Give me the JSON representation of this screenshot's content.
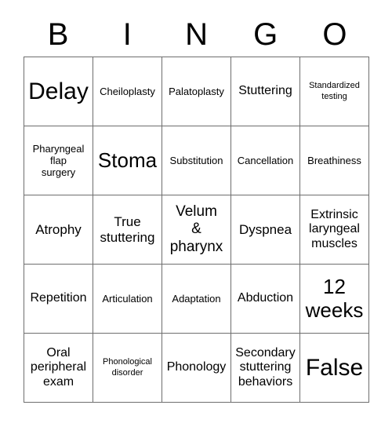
{
  "card": {
    "headers": [
      "B",
      "I",
      "N",
      "G",
      "O"
    ],
    "rows": [
      [
        {
          "text": "Delay",
          "size": "huge"
        },
        {
          "text": "Cheiloplasty",
          "size": "sm"
        },
        {
          "text": "Palatoplasty",
          "size": "sm"
        },
        {
          "text": "Stuttering",
          "size": "md"
        },
        {
          "text": "Standardized\ntesting",
          "size": "xs"
        }
      ],
      [
        {
          "text": "Pharyngeal\nflap\nsurgery",
          "size": "sm"
        },
        {
          "text": "Stoma",
          "size": "xxl"
        },
        {
          "text": "Substitution",
          "size": "sm"
        },
        {
          "text": "Cancellation",
          "size": "sm"
        },
        {
          "text": "Breathiness",
          "size": "sm"
        }
      ],
      [
        {
          "text": "Atrophy",
          "size": "lg"
        },
        {
          "text": "True\nstuttering",
          "size": "lg"
        },
        {
          "text": "Velum\n&\npharynx",
          "size": "xl"
        },
        {
          "text": "Dyspnea",
          "size": "lg"
        },
        {
          "text": "Extrinsic\nlaryngeal\nmuscles",
          "size": "md"
        }
      ],
      [
        {
          "text": "Repetition",
          "size": "md"
        },
        {
          "text": "Articulation",
          "size": "sm"
        },
        {
          "text": "Adaptation",
          "size": "sm"
        },
        {
          "text": "Abduction",
          "size": "md"
        },
        {
          "text": "12\nweeks",
          "size": "xxl"
        }
      ],
      [
        {
          "text": "Oral\nperipheral\nexam",
          "size": "md"
        },
        {
          "text": "Phonological\ndisorder",
          "size": "xs"
        },
        {
          "text": "Phonology",
          "size": "md"
        },
        {
          "text": "Secondary\nstuttering\nbehaviors",
          "size": "md"
        },
        {
          "text": "False",
          "size": "huge"
        }
      ]
    ]
  },
  "colors": {
    "background": "#ffffff",
    "text": "#000000",
    "border": "#6e6e6e"
  }
}
